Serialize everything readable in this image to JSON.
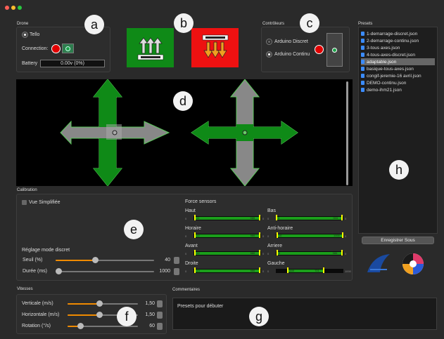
{
  "window": {
    "controls": [
      "close-icon",
      "minimize-icon",
      "zoom-icon"
    ]
  },
  "drone": {
    "group_label": "Drone",
    "radio_label": "Tello",
    "connection_label": "Connection:",
    "battery_label": "Battery",
    "battery_value": "0.00v (0%)"
  },
  "controllers": {
    "group_label": "Contrôleurs",
    "option_discrete": "Arduino Discret",
    "option_continuous": "Arduino Continu"
  },
  "presets": {
    "group_label": "Presets",
    "items": [
      "1-demarrage-discret.json",
      "2-demarrage-continu.json",
      "3-tous axes.json",
      "4-tous-axes-discret.json",
      "adaptable.json",
      "basique-tous-axes.json",
      "congif-jeremie-16 avril.json",
      "DEMO-continu.json",
      "demo-ihm21.json"
    ],
    "selected_index": 4,
    "save_as_label": "Enregistrer Sous"
  },
  "calibration": {
    "group_label": "Calibration",
    "simplified_label": "Vue Simplifiée",
    "discrete_title": "Réglage mode discret",
    "threshold_label": "Seuil (%)",
    "threshold_value": "40",
    "duration_label": "Durée (ms)",
    "duration_value": "1000",
    "force_title": "Force sensors",
    "sensors": [
      {
        "name": "Haut",
        "min": "0",
        "low": "11",
        "high": "985",
        "max": "0"
      },
      {
        "name": "Bas",
        "min": "0",
        "low": "0",
        "high": "993",
        "max": "0"
      },
      {
        "name": "Horaire",
        "min": "0",
        "low": "12",
        "high": "986",
        "max": "0"
      },
      {
        "name": "Anti-horaire",
        "min": "0",
        "low": "10",
        "high": "1000",
        "max": "0"
      },
      {
        "name": "Avant",
        "min": "0",
        "low": "12",
        "high": "986",
        "max": "0"
      },
      {
        "name": "Arriere",
        "min": "0",
        "low": "8",
        "high": "986",
        "max": "0"
      },
      {
        "name": "Droite",
        "min": "0",
        "low": "13",
        "high": "986",
        "max": "0"
      },
      {
        "name": "Gauche",
        "min": "0",
        "low": "169",
        "high": "721",
        "max": "1000"
      }
    ]
  },
  "speeds": {
    "group_label": "Vitesses",
    "items": [
      {
        "label": "Verticale (m/s)",
        "value": "1,50"
      },
      {
        "label": "Horizontale (m/s)",
        "value": "1,50"
      },
      {
        "label": "Rotation (°/s)",
        "value": "60"
      }
    ]
  },
  "comments": {
    "group_label": "Commentaires",
    "text": "Presets pour débuter"
  },
  "callouts": [
    "a",
    "b",
    "c",
    "d",
    "e",
    "f",
    "g",
    "h"
  ],
  "colors": {
    "green": "#0f8a17",
    "red": "#ee1111",
    "panel": "#2d2d2d",
    "orange": "#f08a00"
  }
}
